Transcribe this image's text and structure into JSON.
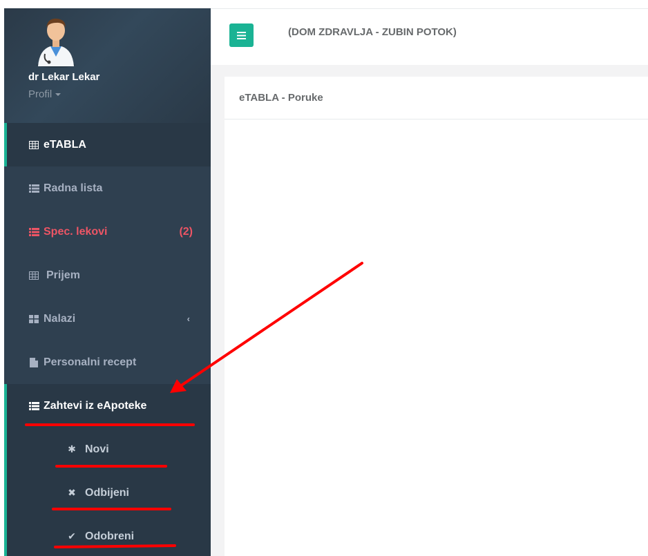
{
  "sidebar": {
    "user_name": "dr Lekar Lekar",
    "profile_label": "Profil",
    "items": [
      {
        "label": "eTABLA",
        "icon": "table-icon",
        "active": true
      },
      {
        "label": "Radna lista",
        "icon": "list-icon"
      },
      {
        "label": "Spec. lekovi",
        "icon": "list-icon",
        "badge": "(2)",
        "color": "#ed5565"
      },
      {
        "label": "Prijem",
        "icon": "table-icon"
      },
      {
        "label": "Nalazi",
        "icon": "th-large-icon",
        "expand_icon": "chevron-left-icon"
      },
      {
        "label": "Personalni recept",
        "icon": "file-icon"
      },
      {
        "label": "Zahtevi iz eApoteke",
        "icon": "list-icon",
        "expanded": true
      }
    ],
    "subitems": [
      {
        "label": "Novi",
        "icon": "asterisk-icon"
      },
      {
        "label": "Odbijeni",
        "icon": "times-icon"
      },
      {
        "label": "Odobreni",
        "icon": "check-icon"
      }
    ]
  },
  "header": {
    "menu_button_icon": "hamburger-icon",
    "facility": "(DOM ZDRAVLJA - ZUBIN POTOK)"
  },
  "panel": {
    "title": "eTABLA - Poruke"
  },
  "colors": {
    "sidebar_bg": "#2f4050",
    "accent": "#1ab394",
    "danger": "#ed5565",
    "annotation": "#ff0000"
  }
}
